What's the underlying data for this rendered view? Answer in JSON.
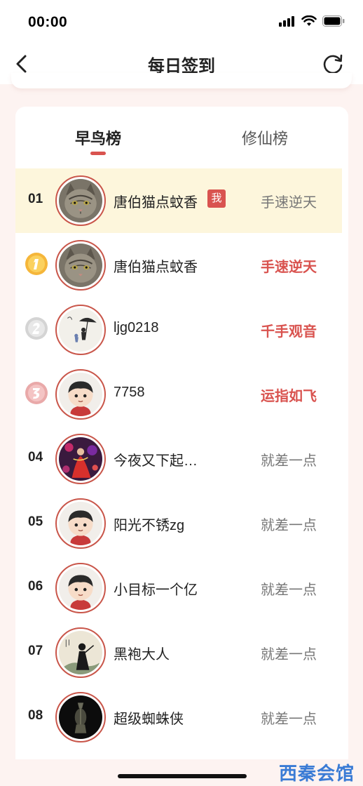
{
  "status_bar": {
    "time": "00:00"
  },
  "header": {
    "title": "每日签到"
  },
  "tabs": [
    {
      "label": "早鸟榜",
      "active": true
    },
    {
      "label": "修仙榜",
      "active": false
    }
  ],
  "me_badge": "我",
  "rows": [
    {
      "rank": "01",
      "name": "唐伯猫点蚊香",
      "title": "手速逆天",
      "highlight": true,
      "avatar": "cat-avatar"
    },
    {
      "rank": "1",
      "medal": "gold",
      "name": "唐伯猫点蚊香",
      "title": "手速逆天",
      "avatar": "cat-avatar"
    },
    {
      "rank": "2",
      "medal": "silver",
      "name": "ljg0218",
      "title": "千手观音",
      "avatar": "umbrella-sketch-avatar"
    },
    {
      "rank": "3",
      "medal": "bronze",
      "name": "7758",
      "title": "运指如飞",
      "avatar": "cartoon-boy-avatar"
    },
    {
      "rank": "04",
      "name": "今夜又下起…",
      "title": "就差一点",
      "avatar": "dancer-avatar"
    },
    {
      "rank": "05",
      "name": "阳光不锈zg",
      "title": "就差一点",
      "avatar": "cartoon-boy-avatar"
    },
    {
      "rank": "06",
      "name": "小目标一个亿",
      "title": "就差一点",
      "avatar": "cartoon-boy-avatar"
    },
    {
      "rank": "07",
      "name": "黑袍大人",
      "title": "就差一点",
      "avatar": "ink-painting-avatar"
    },
    {
      "rank": "08",
      "name": "超级蜘蛛侠",
      "title": "就差一点",
      "avatar": "dark-object-avatar"
    }
  ],
  "watermark": "西秦会馆",
  "colors": {
    "accent": "#d9534f",
    "highlight_row": "#fdf6dc",
    "background": "#fdf3f1"
  }
}
